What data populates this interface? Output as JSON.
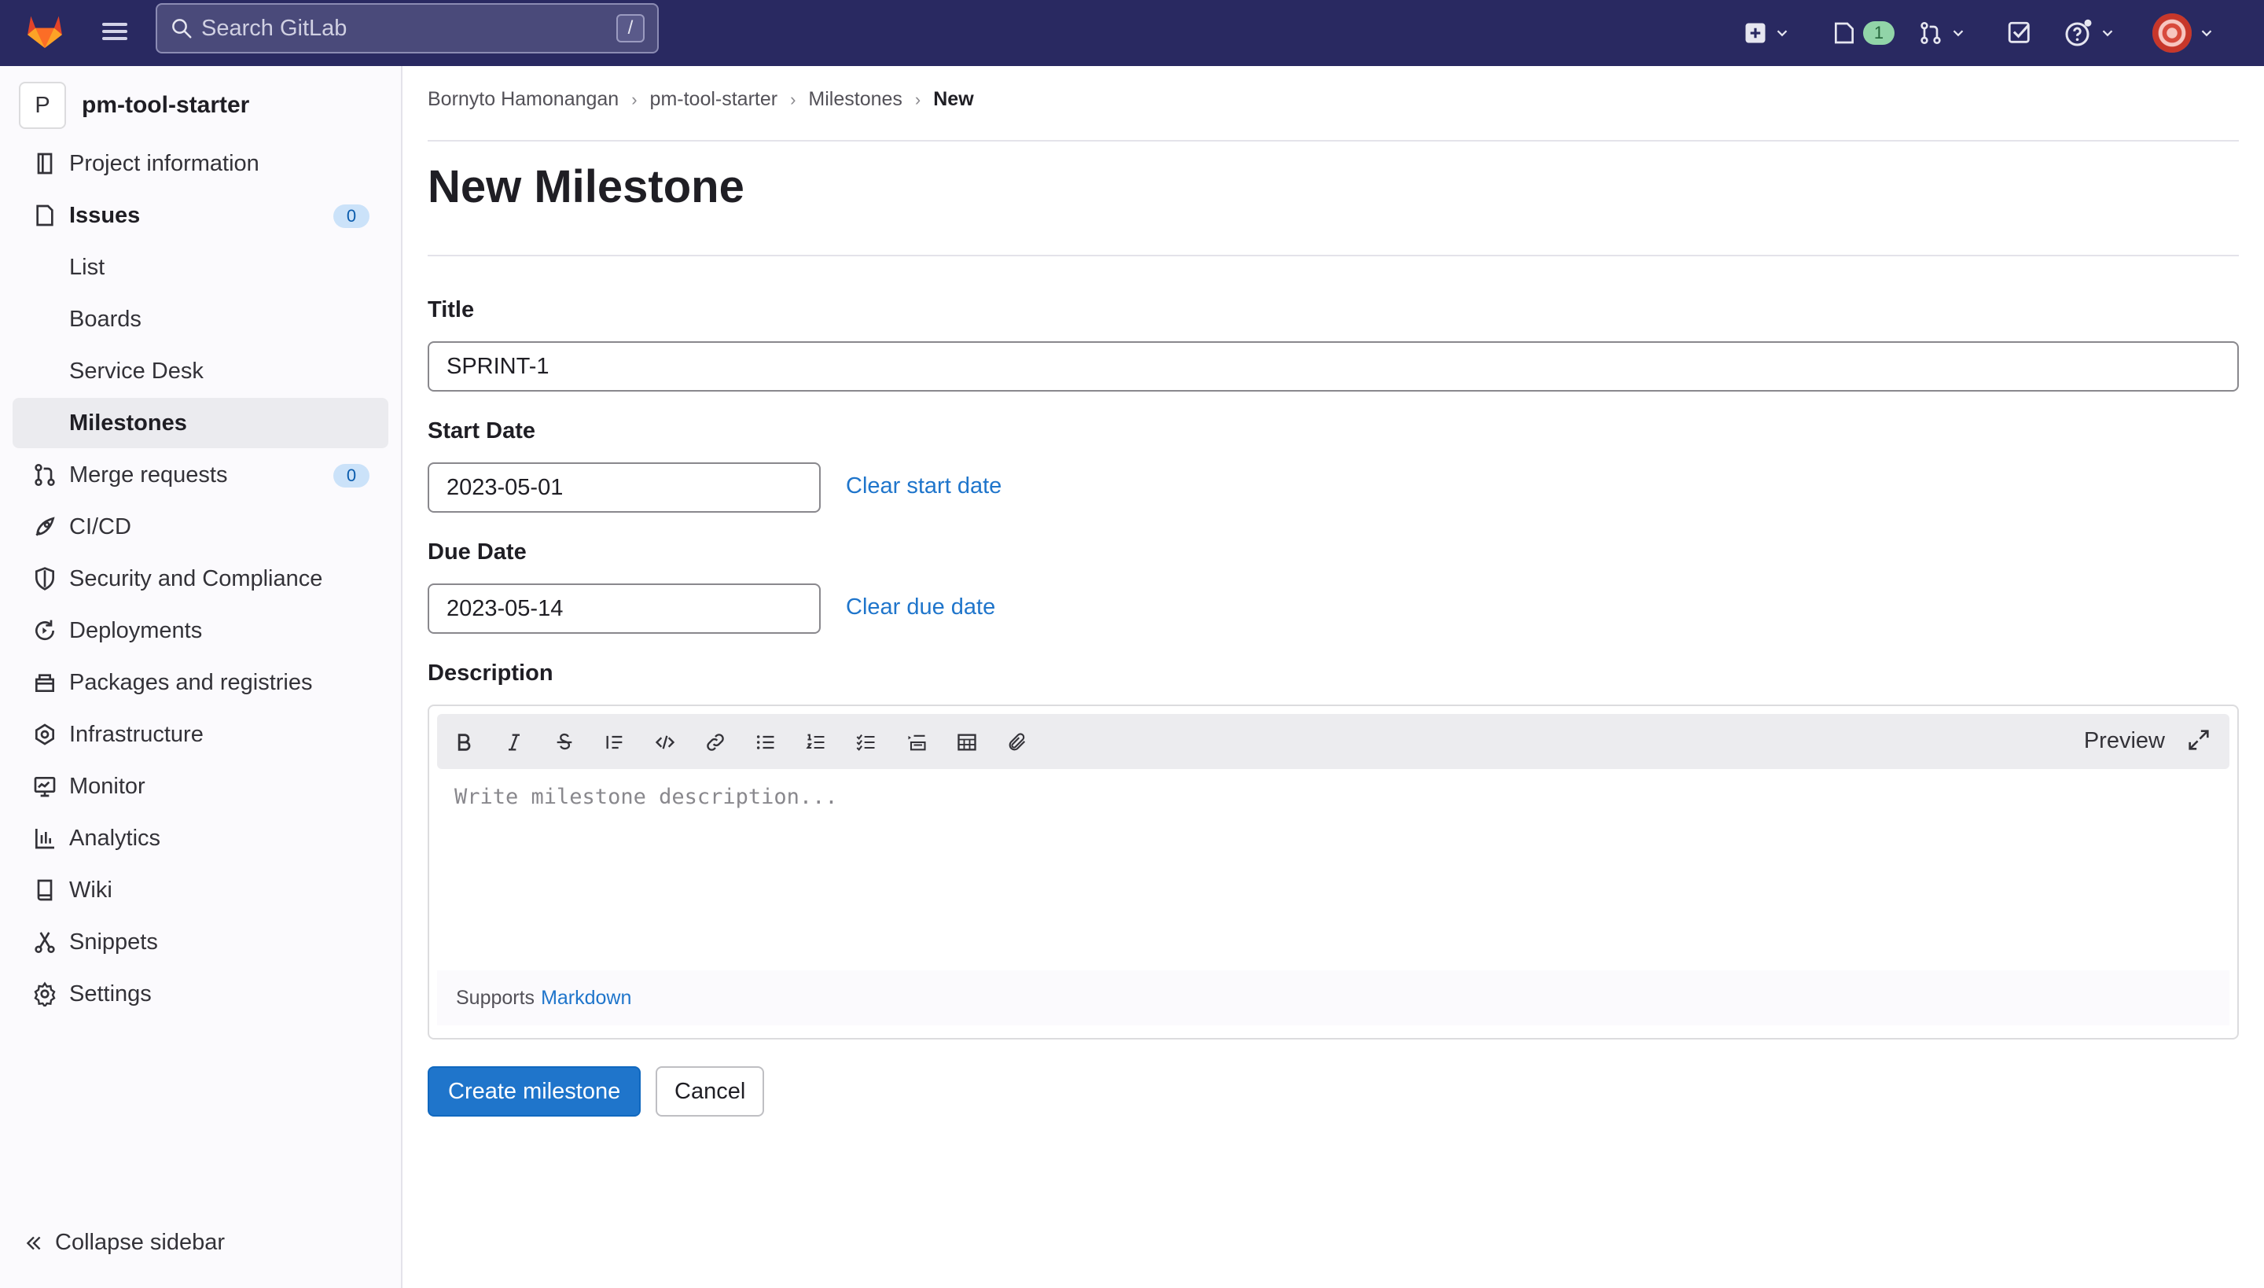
{
  "topbar": {
    "search_placeholder": "Search GitLab",
    "search_shortcut": "/",
    "issues_count": "1"
  },
  "sidebar": {
    "project_initial": "P",
    "project_name": "pm-tool-starter",
    "items": [
      {
        "label": "Project information",
        "icon": "info-icon"
      },
      {
        "label": "Issues",
        "icon": "issues-icon",
        "count": "0"
      },
      {
        "label": "List"
      },
      {
        "label": "Boards"
      },
      {
        "label": "Service Desk"
      },
      {
        "label": "Milestones"
      },
      {
        "label": "Merge requests",
        "icon": "merge-request-icon",
        "count": "0"
      },
      {
        "label": "CI/CD",
        "icon": "rocket-icon"
      },
      {
        "label": "Security and Compliance",
        "icon": "shield-icon"
      },
      {
        "label": "Deployments",
        "icon": "deployments-icon"
      },
      {
        "label": "Packages and registries",
        "icon": "package-icon"
      },
      {
        "label": "Infrastructure",
        "icon": "cloud-gear-icon"
      },
      {
        "label": "Monitor",
        "icon": "monitor-icon"
      },
      {
        "label": "Analytics",
        "icon": "chart-icon"
      },
      {
        "label": "Wiki",
        "icon": "book-icon"
      },
      {
        "label": "Snippets",
        "icon": "scissors-icon"
      },
      {
        "label": "Settings",
        "icon": "gear-icon"
      }
    ],
    "collapse_label": "Collapse sidebar"
  },
  "breadcrumb": [
    "Bornyto Hamonangan",
    "pm-tool-starter",
    "Milestones",
    "New"
  ],
  "page_title": "New Milestone",
  "form": {
    "title_label": "Title",
    "title_value": "SPRINT-1",
    "start_label": "Start Date",
    "start_value": "2023-05-01",
    "clear_start": "Clear start date",
    "due_label": "Due Date",
    "due_value": "2023-05-14",
    "clear_due": "Clear due date",
    "description_label": "Description",
    "description_placeholder": "Write milestone description...",
    "preview": "Preview",
    "supports": "Supports",
    "markdown": "Markdown",
    "create_button": "Create milestone",
    "cancel_button": "Cancel"
  },
  "colors": {
    "navbar": "#292961",
    "link": "#1f75cb",
    "primary_button": "#1f75cb"
  }
}
